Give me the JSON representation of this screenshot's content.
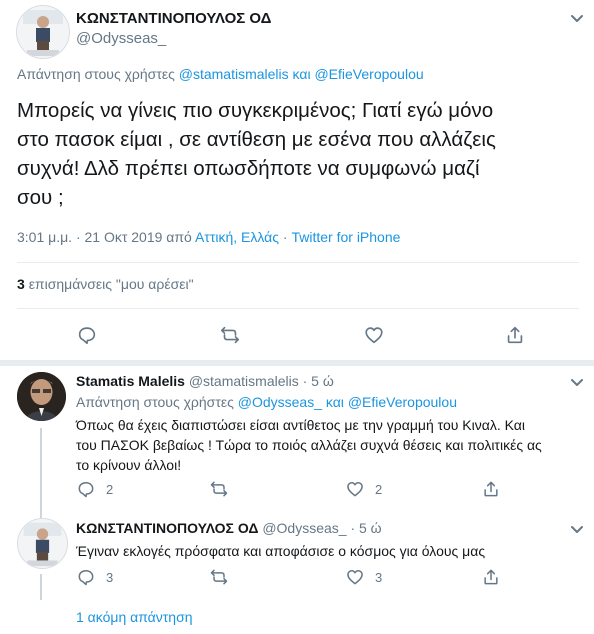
{
  "main_tweet": {
    "author_name": "ΚΩΝΣΤΑΝΤΙΝΟΠΟΥΛΟΣ ΟΔ",
    "author_handle": "@Odysseas_",
    "reply_prefix": "Απάντηση στους χρήστες",
    "reply_user1": "@stamatismalelis",
    "reply_and": "και",
    "reply_user2": "@EfieVeropoulou",
    "text_line1": "Μπορείς να γίνεις πιο συγκεκριμένος; Γιατί εγώ μόνο",
    "text_line2": "στο πασοκ είμαι , σε αντίθεση με εσένα που αλλάζεις",
    "text_line3": "συχνά! Δλδ πρέπει οπωσδήποτε να συμφωνώ μαζί",
    "text_line4": "σου ;",
    "timestamp": "3:01 μ.μ. · 21 Οκτ 2019 από",
    "location": "Αττική, Ελλάς",
    "separator": "·",
    "source": "Twitter for iPhone",
    "likes_count": "3",
    "likes_label": "επισημάνσεις \"μου αρέσει\""
  },
  "replies": [
    {
      "author_name": "Stamatis Malelis",
      "author_handle": "@stamatismalelis",
      "time": "· 5 ώ",
      "reply_prefix": "Απάντηση στους χρήστες",
      "reply_user1": "@Odysseas_",
      "reply_and": "και",
      "reply_user2": "@EfieVeropoulou",
      "text_line1": "Όπως θα έχεις διαπιστώσει είσαι αντίθετος με την γραμμή του Κιναλ. Και",
      "text_line2": "του ΠΑΣΟΚ βεβαίως ! Τώρα το ποιός αλλάζει συχνά θέσεις και πολιτικές ας",
      "text_line3": "το κρίνουν άλλοι!",
      "reply_count": "2",
      "like_count": "2"
    },
    {
      "author_name": "ΚΩΝΣΤΑΝΤΙΝΟΠΟΥΛΟΣ ΟΔ",
      "author_handle": "@Odysseas_",
      "time": "· 5 ώ",
      "text_line1": "Έγιναν εκλογές πρόσφατα και αποφάσισε ο κόσμος για όλους μας",
      "reply_count": "3",
      "like_count": "3"
    }
  ],
  "more_replies": "1 ακόμη απάντηση",
  "colors": {
    "link": "#1b95e0",
    "muted": "#657786",
    "divider": "#e6ecf0"
  },
  "icons": [
    "reply-icon",
    "retweet-icon",
    "like-icon",
    "share-icon",
    "chevron-down-icon"
  ]
}
